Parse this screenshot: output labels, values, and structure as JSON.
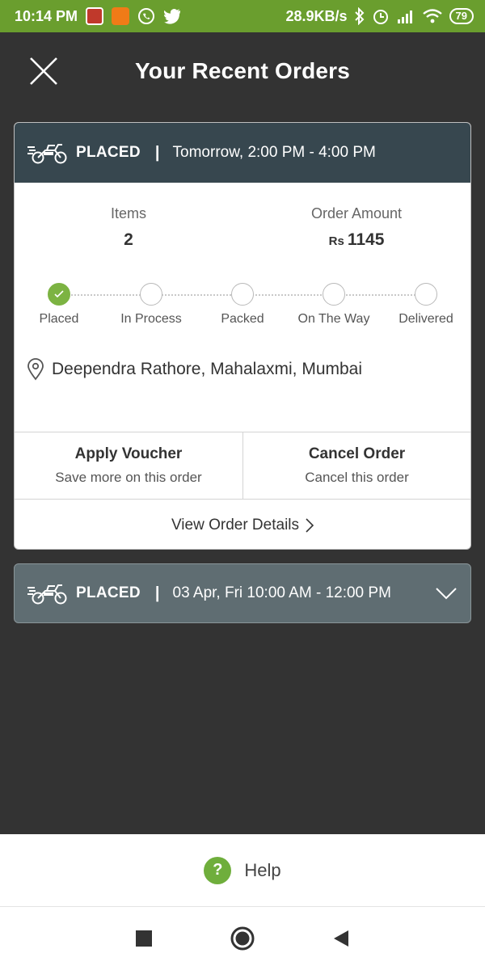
{
  "status_bar": {
    "time": "10:14 PM",
    "network_speed": "28.9KB/s",
    "battery": "79",
    "icons": [
      "app-notification-icon",
      "app-notification-icon",
      "whatsapp-icon",
      "twitter-icon",
      "bluetooth-icon",
      "alarm-icon",
      "signal-icon",
      "wifi-icon",
      "battery-icon"
    ]
  },
  "header": {
    "title": "Your Recent Orders",
    "close_icon": "close-icon"
  },
  "orders": [
    {
      "status": "PLACED",
      "separator": "|",
      "slot": "Tomorrow, 2:00 PM - 4:00 PM",
      "items_label": "Items",
      "items_value": "2",
      "amount_label": "Order Amount",
      "currency": "Rs",
      "amount_value": "1145",
      "steps": [
        {
          "label": "Placed",
          "done": true
        },
        {
          "label": "In Process",
          "done": false
        },
        {
          "label": "Packed",
          "done": false
        },
        {
          "label": "On The Way",
          "done": false
        },
        {
          "label": "Delivered",
          "done": false
        }
      ],
      "address": "Deependra Rathore, Mahalaxmi, Mumbai",
      "actions": [
        {
          "title": "Apply Voucher",
          "subtitle": "Save more on this order"
        },
        {
          "title": "Cancel Order",
          "subtitle": "Cancel this order"
        }
      ],
      "view_details": "View Order Details"
    },
    {
      "status": "PLACED",
      "separator": "|",
      "slot": "03 Apr, Fri 10:00 AM - 12:00 PM"
    }
  ],
  "help": {
    "icon_text": "?",
    "label": "Help"
  },
  "colors": {
    "status_bar": "#6a9e2e",
    "background": "#333333",
    "card_header": "#37474f",
    "collapsed_card": "#5f6d72",
    "accent_green": "#7cb342"
  }
}
